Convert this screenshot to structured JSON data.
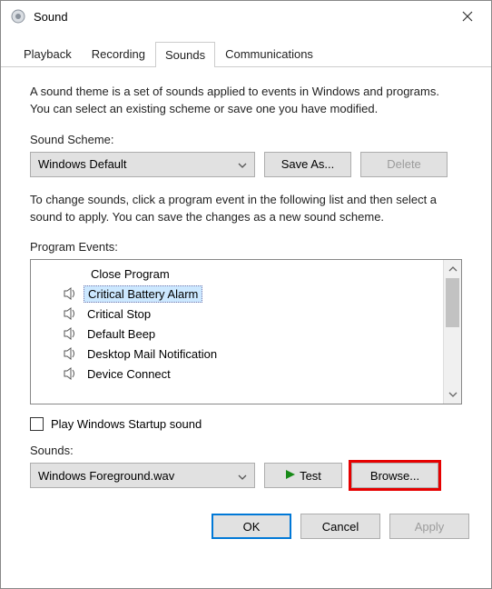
{
  "window": {
    "title": "Sound"
  },
  "tabs": [
    {
      "label": "Playback"
    },
    {
      "label": "Recording"
    },
    {
      "label": "Sounds"
    },
    {
      "label": "Communications"
    }
  ],
  "desc": "A sound theme is a set of sounds applied to events in Windows and programs.  You can select an existing scheme or save one you have modified.",
  "scheme": {
    "label": "Sound Scheme:",
    "value": "Windows Default",
    "saveas": "Save As...",
    "delete": "Delete"
  },
  "desc2": "To change sounds, click a program event in the following list and then select a sound to apply.  You can save the changes as a new sound scheme.",
  "events": {
    "label": "Program Events:",
    "items": [
      {
        "label": "Close Program",
        "has_sound": false,
        "selected": false
      },
      {
        "label": "Critical Battery Alarm",
        "has_sound": true,
        "selected": true
      },
      {
        "label": "Critical Stop",
        "has_sound": true,
        "selected": false
      },
      {
        "label": "Default Beep",
        "has_sound": true,
        "selected": false
      },
      {
        "label": "Desktop Mail Notification",
        "has_sound": true,
        "selected": false
      },
      {
        "label": "Device Connect",
        "has_sound": true,
        "selected": false
      }
    ]
  },
  "startup": {
    "label": "Play Windows Startup sound",
    "checked": false
  },
  "sounds": {
    "label": "Sounds:",
    "value": "Windows Foreground.wav",
    "test": "Test",
    "browse": "Browse..."
  },
  "dlg": {
    "ok": "OK",
    "cancel": "Cancel",
    "apply": "Apply"
  }
}
